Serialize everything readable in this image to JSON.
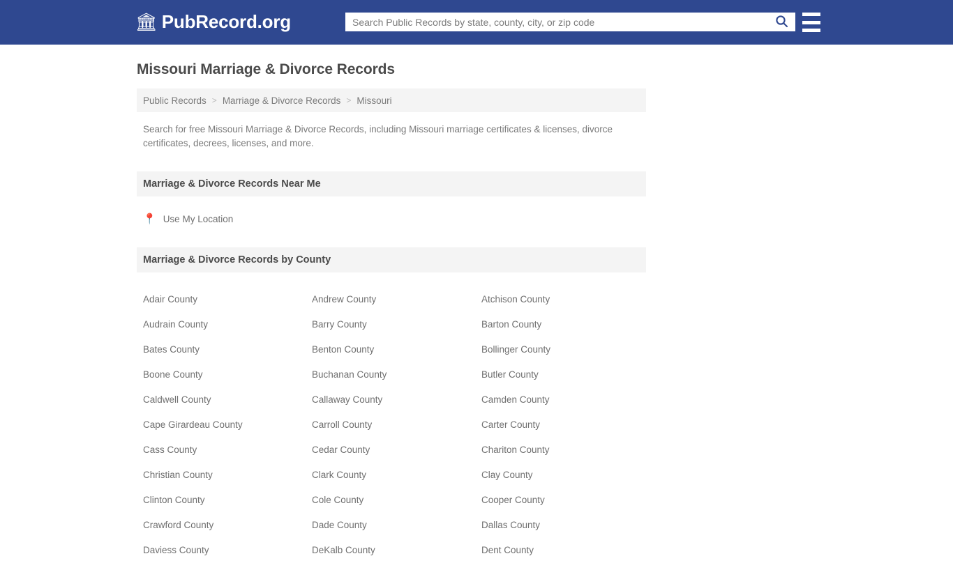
{
  "header": {
    "brand_icon": "bank-icon",
    "brand_text": "PubRecord.org",
    "search_placeholder": "Search Public Records by state, county, city, or zip code",
    "search_value": "",
    "search_icon": "search-icon",
    "menu_icon": "hamburger-menu-icon",
    "background_color": "#2f4890"
  },
  "page": {
    "title": "Missouri Marriage & Divorce Records",
    "intro": "Search for free Missouri Marriage & Divorce Records, including Missouri marriage certificates & licenses, divorce certificates, decrees, licenses, and more."
  },
  "breadcrumb": {
    "items": [
      "Public Records",
      "Marriage & Divorce Records",
      "Missouri"
    ],
    "separator": ">"
  },
  "near_me": {
    "heading": "Marriage & Divorce Records Near Me",
    "location_icon": "map-pin-icon",
    "location_label": "Use My Location"
  },
  "by_county": {
    "heading": "Marriage & Divorce Records by County",
    "counties": [
      "Adair County",
      "Andrew County",
      "Atchison County",
      "Audrain County",
      "Barry County",
      "Barton County",
      "Bates County",
      "Benton County",
      "Bollinger County",
      "Boone County",
      "Buchanan County",
      "Butler County",
      "Caldwell County",
      "Callaway County",
      "Camden County",
      "Cape Girardeau County",
      "Carroll County",
      "Carter County",
      "Cass County",
      "Cedar County",
      "Chariton County",
      "Christian County",
      "Clark County",
      "Clay County",
      "Clinton County",
      "Cole County",
      "Cooper County",
      "Crawford County",
      "Dade County",
      "Dallas County",
      "Daviess County",
      "DeKalb County",
      "Dent County"
    ]
  }
}
